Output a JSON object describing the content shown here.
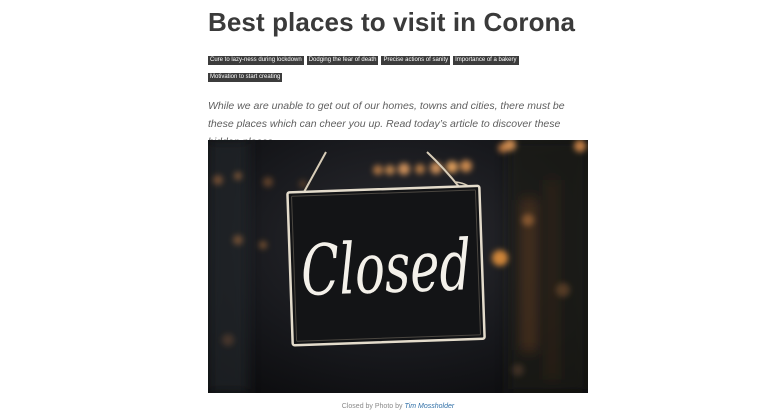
{
  "article": {
    "title": "Best places to visit in Corona",
    "tags": [
      "Cure to lazy-ness during lockdown",
      "Dodging the fear of death",
      "Precise actions of sanity",
      "Importance of a bakery",
      "Motivation to start creating"
    ],
    "lead": "While we are unable to get out of our homes, towns and cities, there must be these places which can cheer you up. Read today’s article to discover these hidden places.",
    "image": {
      "sign_text": "Closed"
    },
    "caption": {
      "prefix": "Closed by Photo by",
      "author": "Tim Mossholder"
    }
  }
}
